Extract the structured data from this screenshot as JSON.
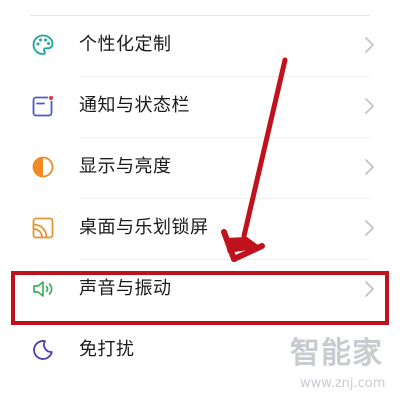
{
  "settings_list": {
    "items": [
      {
        "label": "个性化定制",
        "icon": "palette-icon"
      },
      {
        "label": "通知与状态栏",
        "icon": "notification-icon"
      },
      {
        "label": "显示与亮度",
        "icon": "brightness-icon"
      },
      {
        "label": "桌面与乐划锁屏",
        "icon": "wallpaper-icon"
      },
      {
        "label": "声音与振动",
        "icon": "speaker-icon"
      },
      {
        "label": "免打扰",
        "icon": "moon-icon"
      }
    ]
  },
  "annotation": {
    "highlight_color": "#c0121c",
    "highlighted_item": "声音与振动"
  },
  "watermark": {
    "logo": "智能家",
    "url": "www.znj.com"
  },
  "colors": {
    "palette": "#1fa69a",
    "notification": "#4a5bd0",
    "notification_dot": "#e5364a",
    "brightness": "#f08a24",
    "wallpaper": "#e8932e",
    "speaker": "#3fae5b",
    "moon": "#4a3fb5"
  }
}
